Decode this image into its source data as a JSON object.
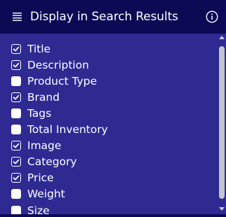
{
  "header": {
    "title": "Display in Search Results",
    "menu_icon": "menu-lines-icon",
    "info_icon": "info-circle-icon"
  },
  "colors": {
    "header_bg": "#0c0a55",
    "panel_bg": "#2e2a92",
    "text": "#ffffff"
  },
  "items": [
    {
      "label": "Title",
      "checked": true
    },
    {
      "label": "Description",
      "checked": true
    },
    {
      "label": "Product Type",
      "checked": false
    },
    {
      "label": "Brand",
      "checked": true
    },
    {
      "label": "Tags",
      "checked": false
    },
    {
      "label": "Total Inventory",
      "checked": false
    },
    {
      "label": "Image",
      "checked": true
    },
    {
      "label": "Category",
      "checked": true
    },
    {
      "label": "Price",
      "checked": true
    },
    {
      "label": "Weight",
      "checked": false
    },
    {
      "label": "Size",
      "checked": false
    }
  ]
}
